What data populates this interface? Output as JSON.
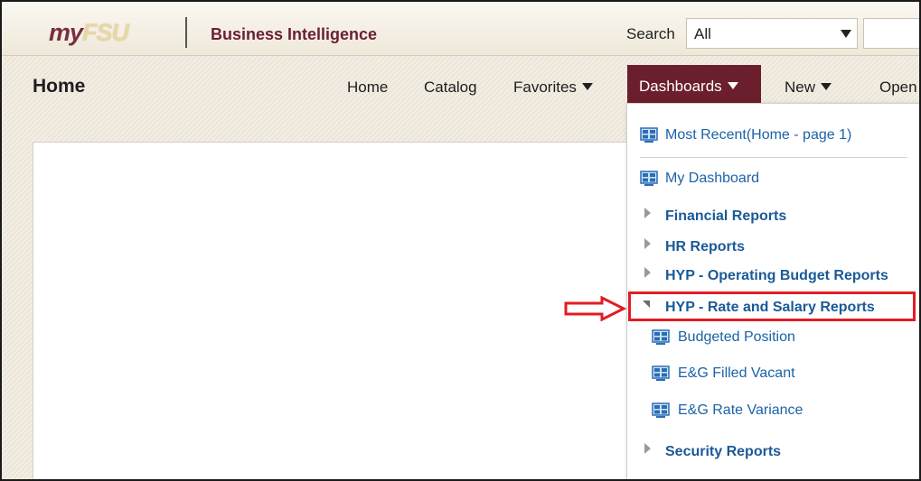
{
  "header": {
    "logo": {
      "my": "my",
      "fsu": "FSU"
    },
    "app_title": "Business Intelligence",
    "search": {
      "label": "Search",
      "scope_value": "All"
    }
  },
  "nav": {
    "page_title": "Home",
    "items": [
      {
        "label": "Home"
      },
      {
        "label": "Catalog"
      },
      {
        "label": "Favorites",
        "has_caret": true
      },
      {
        "label": "Dashboards",
        "has_caret": true,
        "active": true
      },
      {
        "label": "New",
        "has_caret": true
      },
      {
        "label": "Open"
      }
    ]
  },
  "dropdown": {
    "most_recent": "Most Recent(Home - page 1)",
    "my_dashboard": "My Dashboard",
    "groups": [
      {
        "label": "Financial Reports",
        "expanded": false
      },
      {
        "label": "HR Reports",
        "expanded": false
      },
      {
        "label": "HYP - Operating Budget Reports",
        "expanded": false
      },
      {
        "label": "HYP - Rate and Salary Reports",
        "expanded": true,
        "highlighted": true
      },
      {
        "label": "Security Reports",
        "expanded": false
      }
    ],
    "sub_items": [
      {
        "label": "Budgeted Position"
      },
      {
        "label": "E&G Filled Vacant"
      },
      {
        "label": "E&G Rate Variance"
      }
    ]
  },
  "colors": {
    "garnet": "#6b1f2c",
    "link_blue": "#1b63a6",
    "annotation_red": "#e31c24"
  }
}
